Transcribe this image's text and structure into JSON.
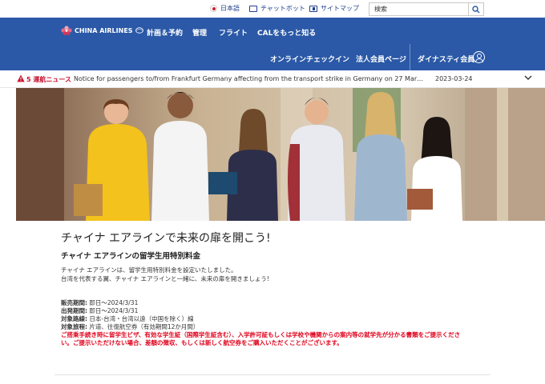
{
  "utility": {
    "language": "日本語",
    "chatbot": "チャットボット",
    "sitemap": "サイトマップ",
    "search_placeholder": "検索"
  },
  "header": {
    "logo_text": "CHINA AIRLINES",
    "main_nav": [
      "計画＆予約",
      "管理",
      "フライト",
      "CALをもっと知る"
    ],
    "sub_nav": [
      "オンラインチェックイン",
      "法人会員ページ",
      "ダイナスティ会員"
    ]
  },
  "news": {
    "count_label": "5 運航ニュース",
    "text": "Notice for passengers to/from Frankfurt Germany affecting from the transport strike in Germany on 27 March…",
    "date": "2023-03-24"
  },
  "content": {
    "title": "チャイナ エアラインで未来の扉を開こう!",
    "subtitle": "チャイナ エアラインの留学生用特別料金",
    "intro": [
      "チャイナ エアラインは、留学生用特別料金を設定いたしました。",
      "台湾を代表する翼、チャイナ エアラインと一緒に、未来の扉を開きましょう!"
    ],
    "details": [
      {
        "label": "販売期間:",
        "value": " 即日〜2024/3/31"
      },
      {
        "label": "出発期間:",
        "value": " 即日〜2024/3/31"
      },
      {
        "label": "対象路線:",
        "value": " 日本-台湾・台湾以遠（中国を除く）線"
      },
      {
        "label": "対象旅程:",
        "value": " 片道、往復航空券（有効期間12か月間）"
      }
    ],
    "warning": [
      "ご搭乗手続き時に留学生ビザ、有効な学生証（国際学生証含む）、入学許可証もしくは学校や機関からの案内等の就学先が分かる書類をご提示くださ",
      "い。ご提示いただけない場合、差額の徴収、もしくは新しく航空券をご購入いただくことがございます。"
    ]
  },
  "colors": {
    "brand_blue": "#2b59a7",
    "alert_red": "#c8102e",
    "warning_red": "#e0001b"
  }
}
